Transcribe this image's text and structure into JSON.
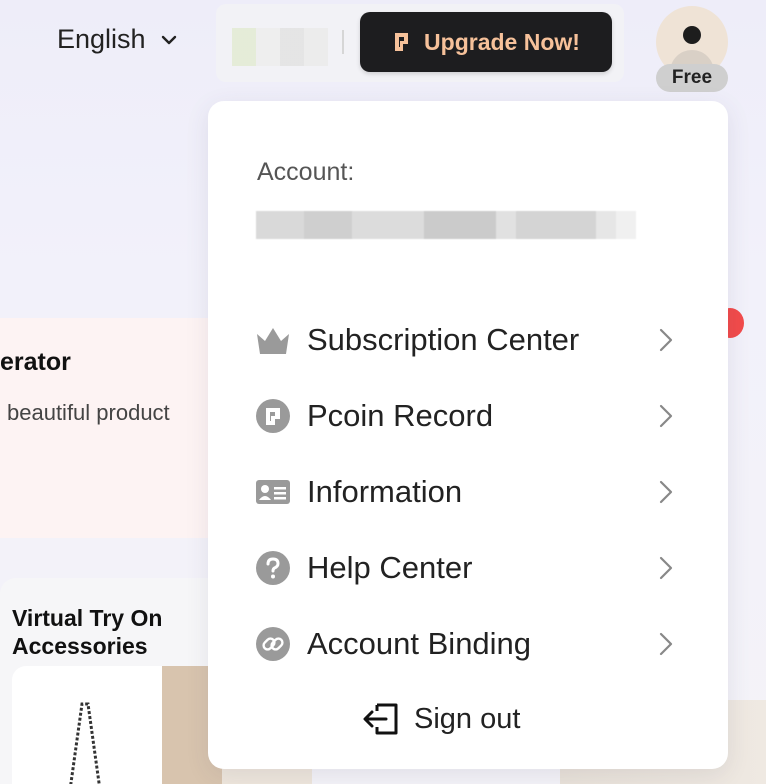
{
  "header": {
    "language": "English",
    "upgrade_label": "Upgrade Now!",
    "plan_badge": "Free"
  },
  "background": {
    "card_title_fragment": "erator",
    "card_desc_fragment": "beautiful product",
    "card2_title_line1": "Virtual Try On",
    "card2_title_line2": "Accessories"
  },
  "account_menu": {
    "account_label": "Account:",
    "items": [
      {
        "label": "Subscription Center",
        "icon": "crown-icon"
      },
      {
        "label": "Pcoin Record",
        "icon": "pcoin-icon"
      },
      {
        "label": "Information",
        "icon": "id-card-icon"
      },
      {
        "label": "Help Center",
        "icon": "question-icon"
      },
      {
        "label": "Account Binding",
        "icon": "link-icon"
      }
    ],
    "sign_out_label": "Sign out"
  },
  "colors": {
    "upgrade_bg": "#1d1d1f",
    "upgrade_text": "#f6c19a",
    "icon_gray": "#9a9a9a",
    "notification": "#f24b4b"
  }
}
